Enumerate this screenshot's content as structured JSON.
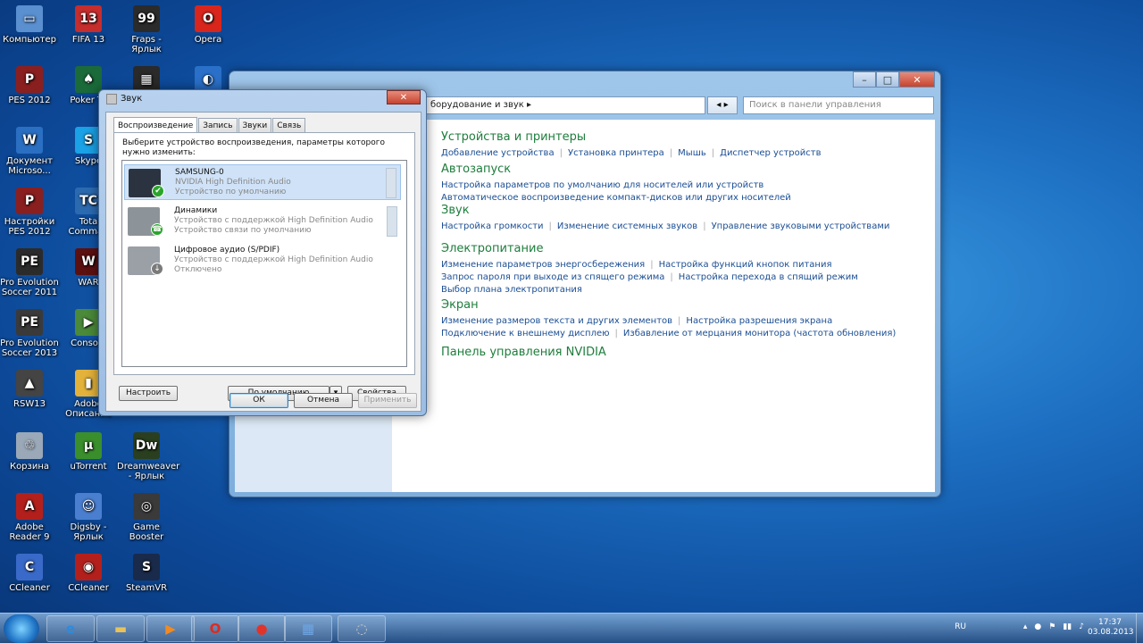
{
  "desktop_icons": [
    {
      "label": "Компьютер",
      "color": "#5a8fd0",
      "glyph": "▭"
    },
    {
      "label": "FIFA 13",
      "color": "#c62d2d",
      "glyph": "13"
    },
    {
      "label": "Fraps - Ярлык",
      "color": "#2b2b2b",
      "glyph": "99"
    },
    {
      "label": "Opera",
      "color": "#d9261c",
      "glyph": "O"
    },
    {
      "label": "PES 2012",
      "color": "#8a1f1f",
      "glyph": "P"
    },
    {
      "label": "Poker Te",
      "color": "#1b6a3a",
      "glyph": "♠"
    },
    {
      "label": "",
      "color": "#2a2a2a",
      "glyph": "▦"
    },
    {
      "label": "",
      "color": "#2a70c9",
      "glyph": "◐"
    },
    {
      "label": "Документ Microso...",
      "color": "#2b6fc2",
      "glyph": "W"
    },
    {
      "label": "Skype",
      "color": "#1aa1e6",
      "glyph": "S"
    },
    {
      "label": "Настройки PES 2012",
      "color": "#8a1f1f",
      "glyph": "P"
    },
    {
      "label": "Tota Comman",
      "color": "#2c6ab0",
      "glyph": "TC"
    },
    {
      "label": "Pro Evolution Soccer 2011",
      "color": "#2b2b2b",
      "glyph": "PE"
    },
    {
      "label": "WAR",
      "color": "#5c1010",
      "glyph": "W"
    },
    {
      "label": "Pro Evolution Soccer 2013",
      "color": "#3a3a3a",
      "glyph": "PE"
    },
    {
      "label": "Consola ",
      "color": "#4b8a3a",
      "glyph": "▶"
    },
    {
      "label": "RSW13",
      "color": "#444444",
      "glyph": "▲"
    },
    {
      "label": "Adobe Описание",
      "color": "#e2b23a",
      "glyph": "▮"
    },
    {
      "label": "Корзина",
      "color": "#9aa8b8",
      "glyph": "♲"
    },
    {
      "label": "uTorrent",
      "color": "#3a8f2c",
      "glyph": "μ"
    },
    {
      "label": "Dreamweaver - Ярлык",
      "color": "#2a3f1f",
      "glyph": "Dw"
    },
    {
      "label": "Adobe Reader 9",
      "color": "#b3201c",
      "glyph": "A"
    },
    {
      "label": "Digsby - Ярлык",
      "color": "#4a7fd0",
      "glyph": "☺"
    },
    {
      "label": "Game Booster",
      "color": "#3a3a3a",
      "glyph": "◎"
    },
    {
      "label": "CCleaner",
      "color": "#3a6ac9",
      "glyph": "C"
    },
    {
      "label": "CCleaner",
      "color": "#b3201c",
      "glyph": "◉"
    },
    {
      "label": "SteamVR",
      "color": "#1a2a4a",
      "glyph": "S"
    }
  ],
  "control_panel": {
    "address": "борудование и звук  ▸",
    "nav": "◂ ▸",
    "search_placeholder": "Поиск в панели управления",
    "window_controls": [
      "–",
      "□",
      "✕"
    ],
    "categories": [
      {
        "title": "Устройства и принтеры",
        "rows": [
          [
            "Добавление устройства",
            "Установка принтера",
            "Мышь",
            "Диспетчер устройств"
          ]
        ]
      },
      {
        "title": "Автозапуск",
        "rows": [
          [
            "Настройка параметров по умолчанию для носителей или устройств"
          ],
          [
            "Автоматическое воспроизведение компакт-дисков или других носителей"
          ]
        ]
      },
      {
        "title": "Звук",
        "rows": [
          [
            "Настройка громкости",
            "Изменение системных звуков",
            "Управление звуковыми устройствами"
          ]
        ]
      },
      {
        "title": "Электропитание",
        "rows": [
          [
            "Изменение параметров энергосбережения",
            "Настройка функций кнопок питания"
          ],
          [
            "Запрос пароля при выходе из спящего режима",
            "Настройка перехода в спящий режим"
          ],
          [
            "Выбор плана электропитания"
          ]
        ]
      },
      {
        "title": "Экран",
        "rows": [
          [
            "Изменение размеров текста и других элементов",
            "Настройка разрешения экрана"
          ],
          [
            "Подключение к внешнему дисплею",
            "Избавление от мерцания монитора (частота обновления)"
          ]
        ]
      },
      {
        "title": "Панель управления NVIDIA",
        "rows": []
      }
    ]
  },
  "sound_dialog": {
    "title": "Звук",
    "close": "✕",
    "tabs": [
      "Воспроизведение",
      "Запись",
      "Звуки",
      "Связь"
    ],
    "instruction": "Выберите устройство воспроизведения, параметры которого нужно изменить:",
    "devices": [
      {
        "name": "SAMSUNG-0",
        "line1": "NVIDIA High Definition Audio",
        "line2": "Устройство по умолчанию",
        "status_color": "#2aa52a",
        "status_glyph": "✔",
        "icon_color": "#2c3340",
        "selected": true
      },
      {
        "name": "Динамики",
        "line1": "Устройство с поддержкой High Definition Audio",
        "line2": "Устройство связи по умолчанию",
        "status_color": "#2aa52a",
        "status_glyph": "☎",
        "icon_color": "#8d9499",
        "selected": false
      },
      {
        "name": "Цифровое аудио (S/PDIF)",
        "line1": "Устройство с поддержкой High Definition Audio",
        "line2": "Отключено",
        "status_color": "#7a7a7a",
        "status_glyph": "↓",
        "icon_color": "#9aa0a6",
        "selected": false
      }
    ],
    "btn_configure": "Настроить",
    "btn_default": "По умолчанию",
    "btn_default_arrow": "▾",
    "btn_properties": "Свойства",
    "btn_ok": "ОК",
    "btn_cancel": "Отмена",
    "btn_apply": "Применить"
  },
  "taskbar": {
    "apps": [
      {
        "name": "ie",
        "glyph": "e",
        "color": "#2d8bdc"
      },
      {
        "name": "explorer",
        "glyph": "▬",
        "color": "#e9c35a"
      },
      {
        "name": "media-player",
        "glyph": "▶",
        "color": "#f08a22"
      },
      {
        "name": "opera",
        "glyph": "O",
        "color": "#e02a1d"
      },
      {
        "name": "record",
        "glyph": "●",
        "color": "#e0342a"
      },
      {
        "name": "control-panel",
        "glyph": "▦",
        "color": "#6ea6e6"
      },
      {
        "name": "sound",
        "glyph": "◌",
        "color": "#c9c9c9"
      }
    ],
    "lang": "RU",
    "time": "17:37",
    "date": "03.08.2013",
    "tray_icons": [
      "▴",
      "●",
      "⚑",
      "▮▮",
      "♪"
    ]
  }
}
